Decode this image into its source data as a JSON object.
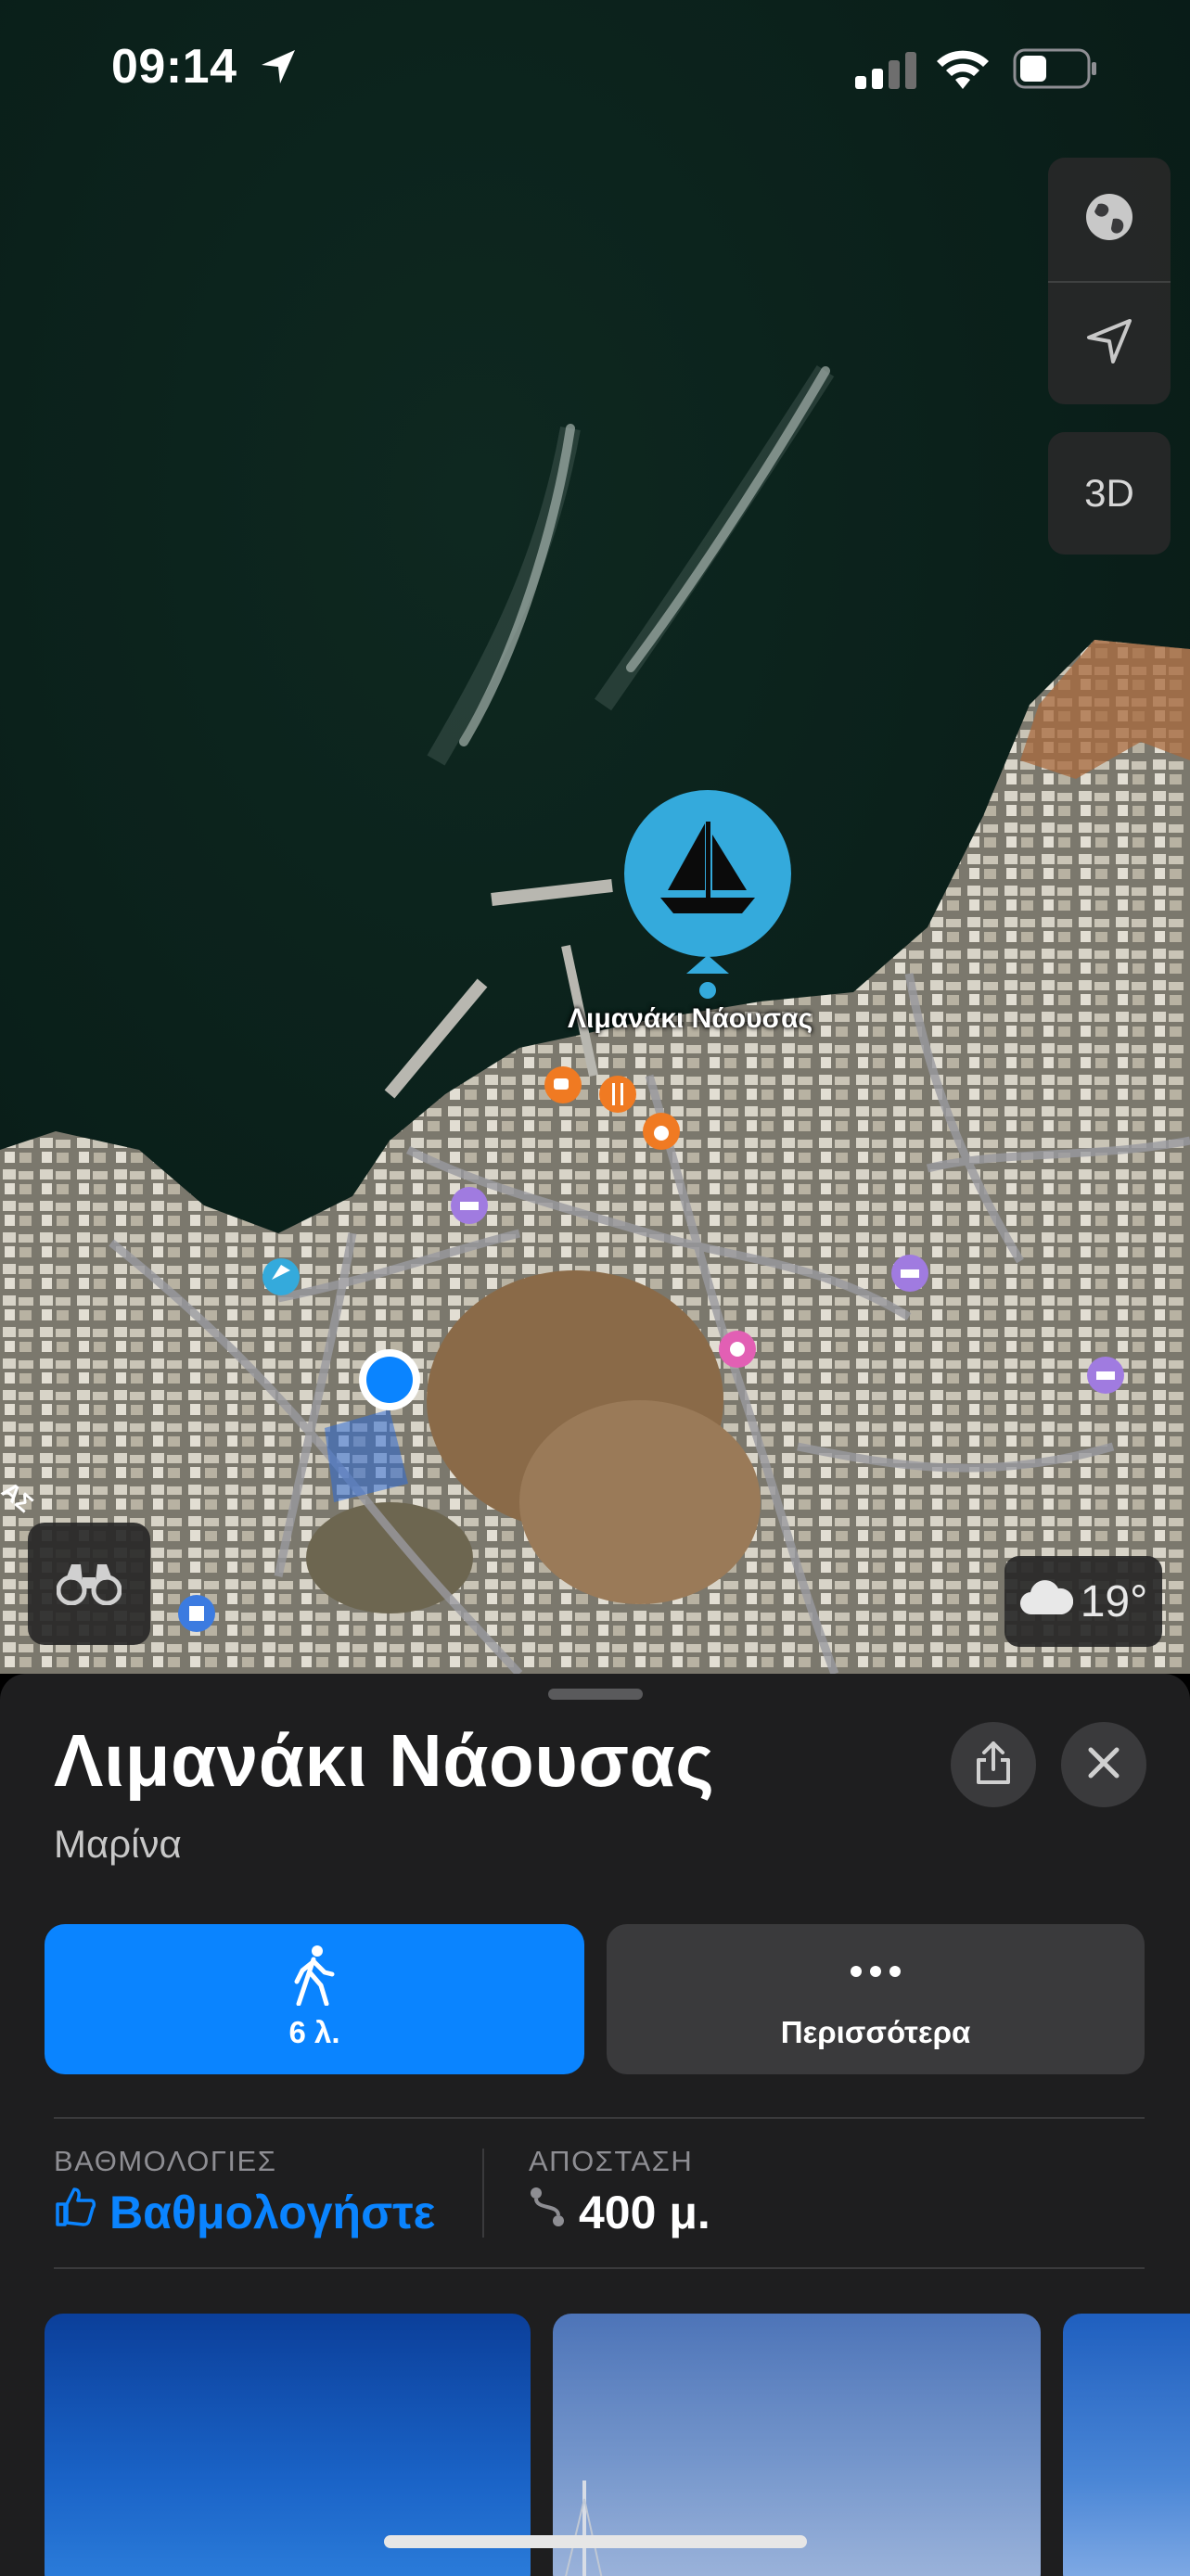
{
  "status_bar": {
    "time": "09:14",
    "icons": [
      "location-arrow-icon",
      "cellular-signal-icon",
      "wifi-icon",
      "battery-icon"
    ]
  },
  "map_controls": {
    "globe_icon": "globe-icon",
    "locate_icon": "location-arrow-icon",
    "view_3d_label": "3D",
    "binoculars_icon": "binoculars-icon"
  },
  "map": {
    "pin_label": "Λιμανάκι Νάουσας",
    "pin_icon": "sailboat-icon",
    "poi_icons": [
      "cafe-icon",
      "restaurant-icon",
      "nightlife-icon",
      "hotel-icon",
      "beach-icon",
      "shopping-icon",
      "parking-icon"
    ]
  },
  "weather": {
    "icon": "cloud-icon",
    "temperature": "19°"
  },
  "place_card": {
    "title": "Λιμανάκι Νάουσας",
    "category": "Μαρίνα",
    "walk_button": {
      "icon": "walking-person-icon",
      "label": "6 λ."
    },
    "more_button": {
      "icon": "ellipsis-icon",
      "label": "Περισσότερα"
    },
    "ratings": {
      "header": "ΒΑΘΜΟΛΟΓΙΕΣ",
      "value": "Βαθμολογήστε",
      "icon": "thumbs-up-icon"
    },
    "distance": {
      "header": "ΑΠΟΣΤΑΣΗ",
      "value": "400 μ.",
      "icon": "route-icon"
    },
    "photos": [
      "photo-sky",
      "photo-boat-mast",
      "photo-sky-partial"
    ]
  },
  "colors": {
    "accent": "#0a84ff",
    "sheet_bg": "#1e1e1f",
    "button_bg": "#3a3a3c",
    "pin_color": "#34aadc"
  }
}
